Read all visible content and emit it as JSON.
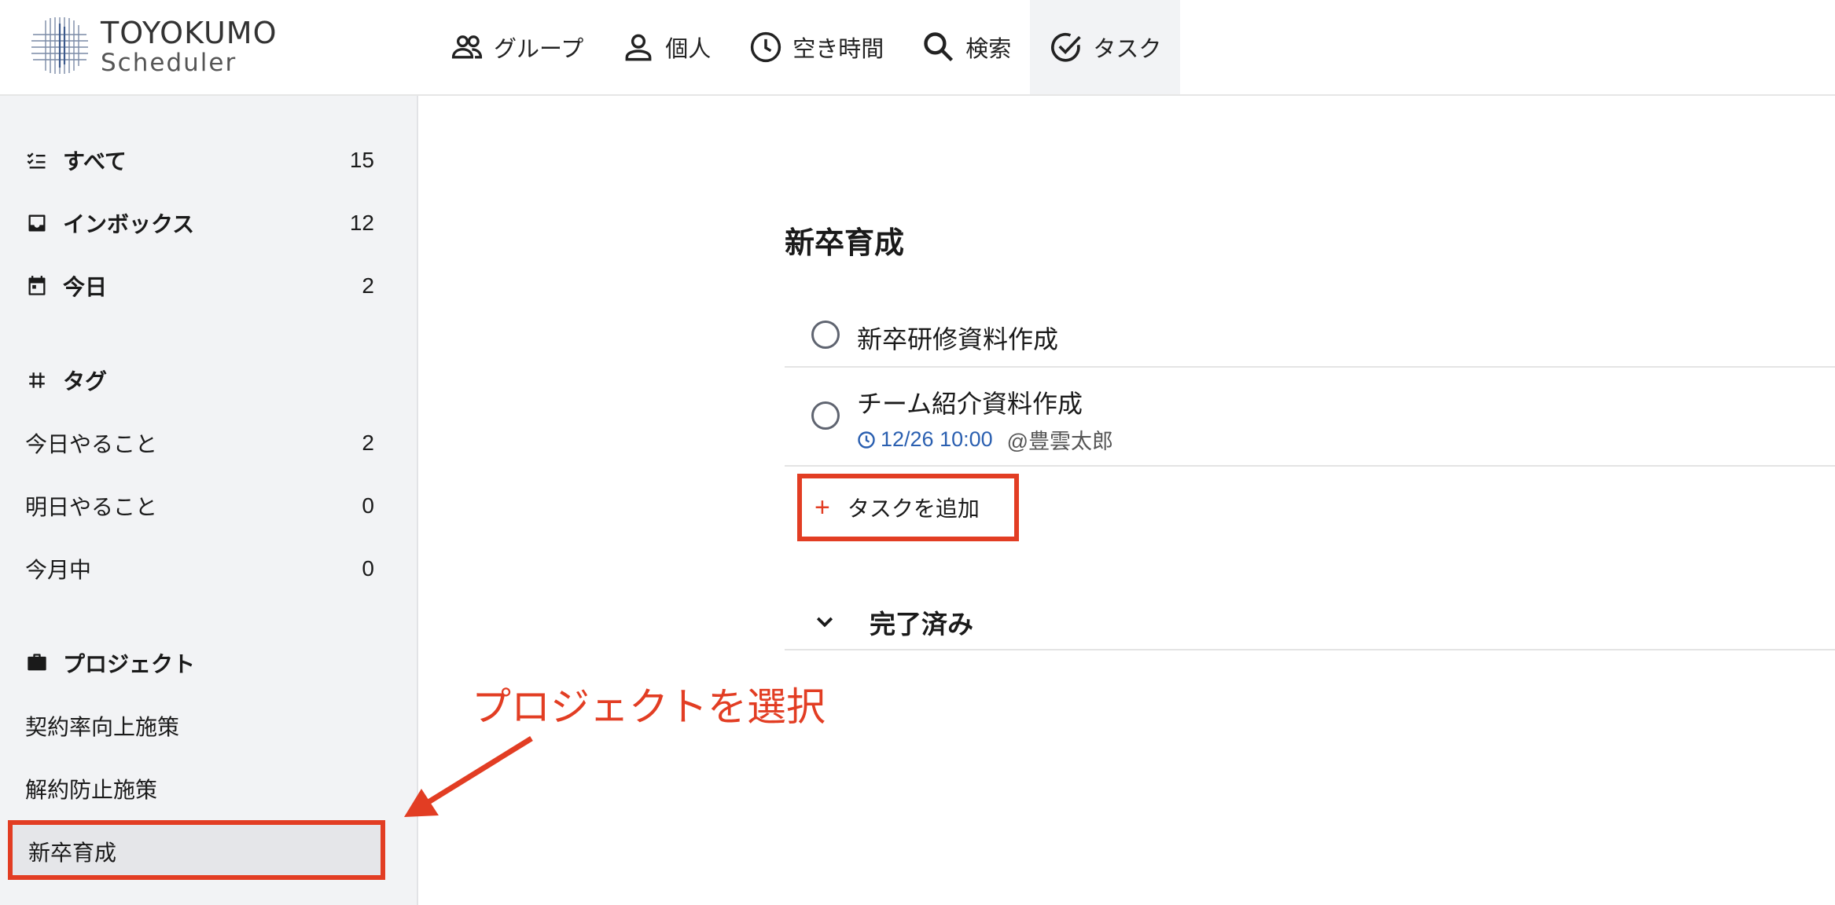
{
  "app": {
    "logo_name": "TOYOKUMO",
    "logo_sub": "Scheduler"
  },
  "nav": [
    {
      "label": "グループ",
      "icon": "group-icon"
    },
    {
      "label": "個人",
      "icon": "person-icon"
    },
    {
      "label": "空き時間",
      "icon": "clock-icon"
    },
    {
      "label": "検索",
      "icon": "search-icon"
    },
    {
      "label": "タスク",
      "icon": "check-circle-icon",
      "active": true
    }
  ],
  "sidebar": {
    "filters": [
      {
        "label": "すべて",
        "count": "15",
        "icon": "checklist-icon"
      },
      {
        "label": "インボックス",
        "count": "12",
        "icon": "inbox-icon"
      },
      {
        "label": "今日",
        "count": "2",
        "icon": "calendar-icon"
      }
    ],
    "tags_header": "タグ",
    "tags": [
      {
        "label": "今日やること",
        "count": "2"
      },
      {
        "label": "明日やること",
        "count": "0"
      },
      {
        "label": "今月中",
        "count": "0"
      }
    ],
    "projects_header": "プロジェクト",
    "projects": [
      {
        "label": "契約率向上施策"
      },
      {
        "label": "解約防止施策"
      },
      {
        "label": "新卒育成",
        "selected": true
      }
    ]
  },
  "main": {
    "project_title": "新卒育成",
    "tasks": [
      {
        "title": "新卒研修資料作成"
      },
      {
        "title": "チーム紹介資料作成",
        "due": "12/26 10:00",
        "assignee": "@豊雲太郎"
      }
    ],
    "add_task_label": "タスクを追加",
    "completed_label": "完了済み"
  },
  "annotation": {
    "text": "プロジェクトを選択",
    "color": "#e23d23"
  },
  "colors": {
    "accent": "#e23d23",
    "date": "#2a5fb0",
    "sidebar_bg": "#f2f3f5"
  }
}
